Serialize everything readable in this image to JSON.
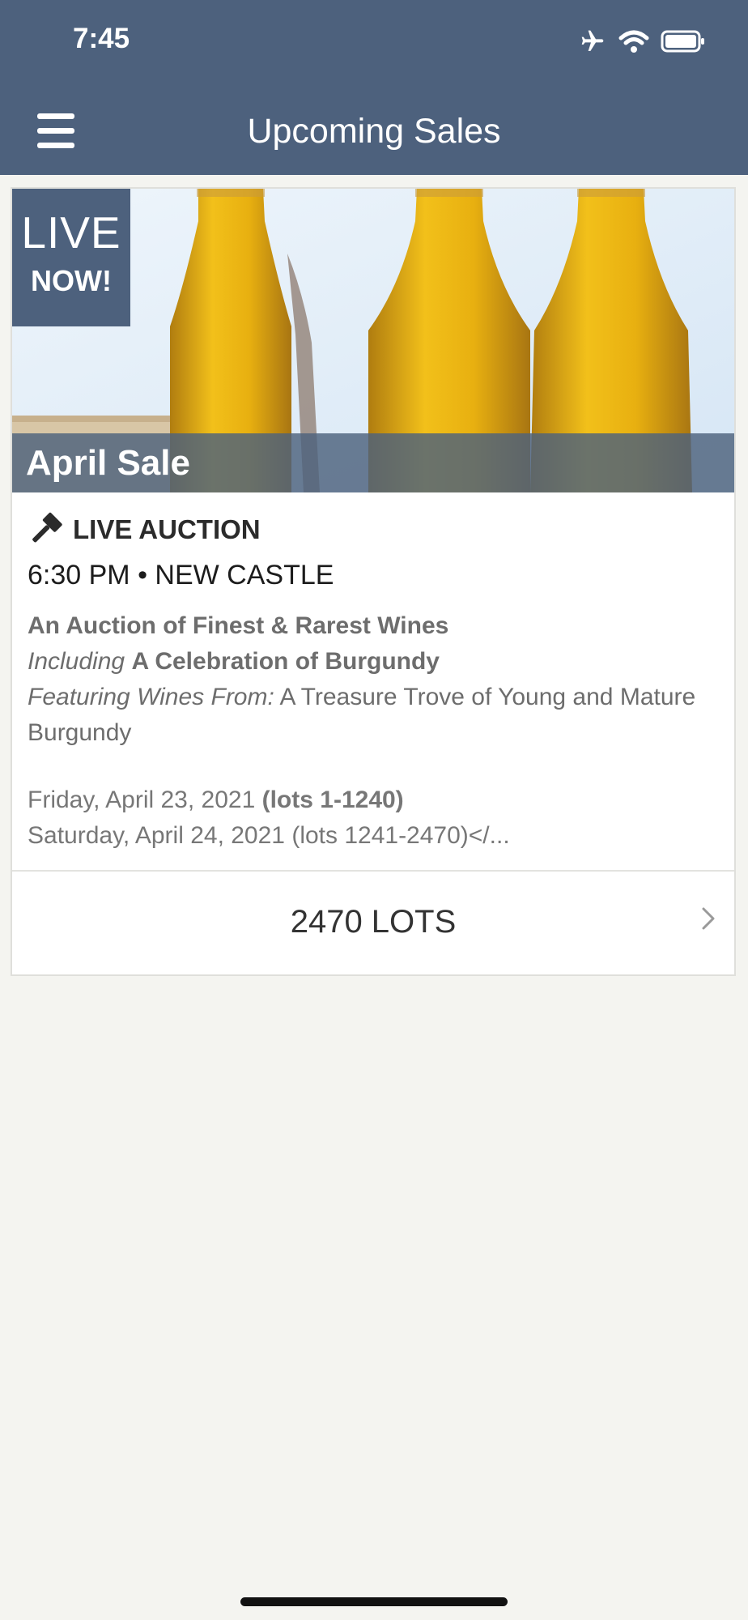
{
  "status_bar": {
    "time": "7:45"
  },
  "nav": {
    "title": "Upcoming Sales"
  },
  "sale": {
    "badge_line1": "LIVE",
    "badge_line2": "NOW!",
    "name": "April Sale",
    "auction_type": "LIVE AUCTION",
    "time_location": "6:30 PM • NEW CASTLE",
    "headline": "An Auction of Finest & Rarest Wines",
    "including_prefix": "Including",
    "including_title": "A Celebration of Burgundy",
    "featuring_prefix": "Featuring Wines From:",
    "featuring_text": "A Treasure Trove of Young and Mature Burgundy",
    "date1_text": "Friday, April 23, 2021",
    "date1_lots": "(lots 1-1240)",
    "date2_text": "Saturday, April 24, 2021 (lots 1241-2470)</...",
    "lots_label": "2470 LOTS"
  },
  "colors": {
    "header": "#4d617d",
    "background": "#f4f4f0"
  },
  "icons": [
    "airplane-icon",
    "wifi-icon",
    "battery-icon",
    "menu-icon",
    "gavel-icon",
    "chevron-right-icon"
  ]
}
